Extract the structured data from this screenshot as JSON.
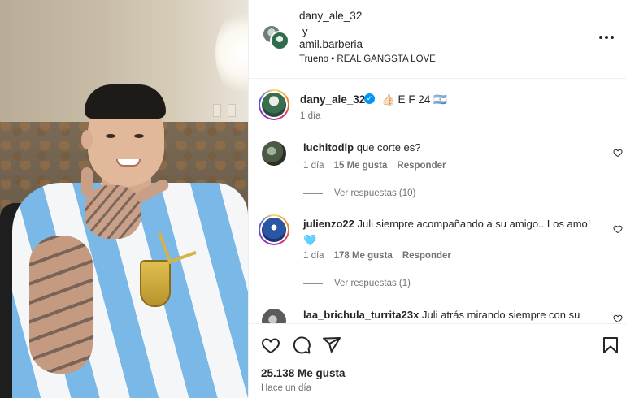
{
  "header": {
    "user1": "dany_ale_32",
    "connector": "y",
    "user2": "amil.barberia",
    "audio": "Trueno • REAL GANGSTA LOVE"
  },
  "caption": {
    "user": "dany_ale_32",
    "text": "👍🏻 E F 24 🇦🇷",
    "time": "1 día"
  },
  "comments": [
    {
      "user": "luchitodlp",
      "text": "que corte es?",
      "time": "1 día",
      "likes": "15 Me gusta",
      "reply": "Responder",
      "view_replies": "Ver respuestas (10)"
    },
    {
      "user": "julienzo22",
      "text": "Juli siempre acompañando a su amigo.. Los amo!",
      "extra": "🩵",
      "time": "1 día",
      "likes": "178 Me gusta",
      "reply": "Responder",
      "view_replies": "Ver respuestas (1)"
    },
    {
      "user": "laa_brichula_turrita23x",
      "text": "Juli atrás mirando siempre con su"
    }
  ],
  "footer": {
    "likes": "25.138 Me gusta",
    "time_ago": "Hace un día"
  },
  "icons": {
    "more": "more-icon",
    "like": "heart-icon",
    "comment": "comment-icon",
    "share": "share-icon",
    "save": "bookmark-icon"
  },
  "colors": {
    "verified": "#0095f6",
    "muted_text": "#737373",
    "text": "#262626"
  }
}
